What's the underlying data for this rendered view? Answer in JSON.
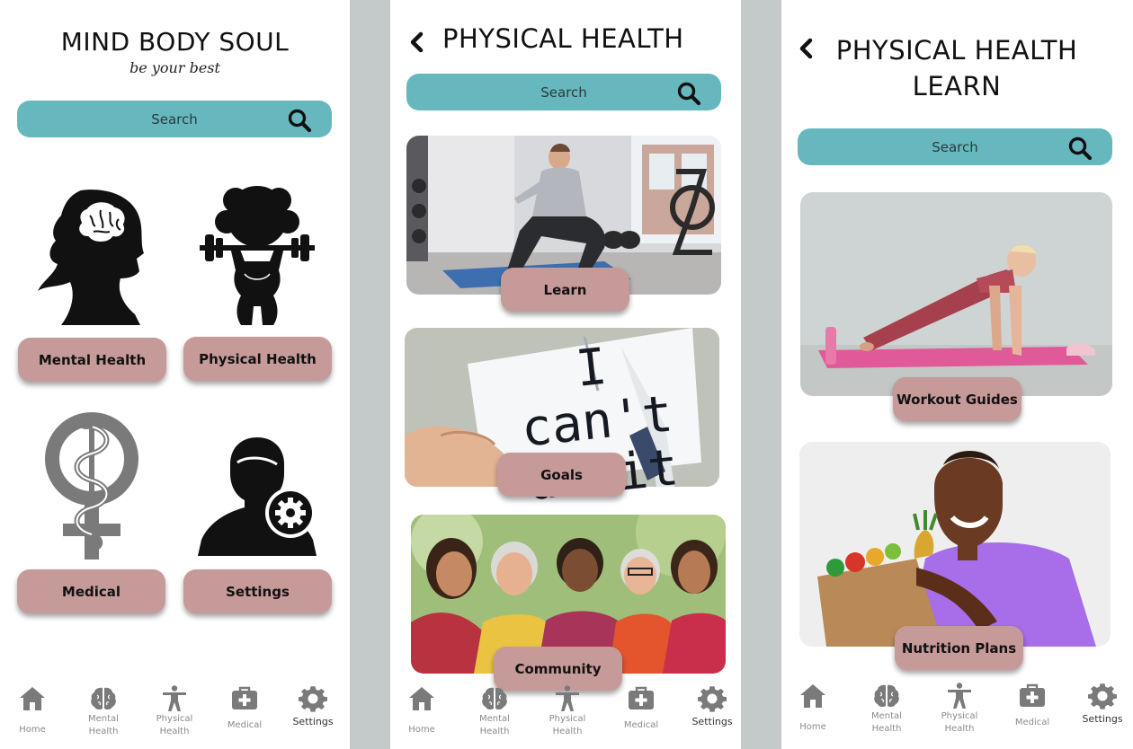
{
  "colors": {
    "search_bg": "#67b8be",
    "pill_bg": "#c79a9a",
    "icon_gray": "#7a7a7a",
    "divider": "#c4c9ca"
  },
  "home": {
    "brand_title": "MIND BODY SOUL",
    "brand_tagline": "be your best",
    "search_placeholder": "Search",
    "tiles": [
      {
        "label": "Mental Health",
        "icon": "woman-brain-silhouette-icon"
      },
      {
        "label": "Physical Health",
        "icon": "woman-barbell-silhouette-icon"
      },
      {
        "label": "Medical",
        "icon": "female-caduceus-icon"
      },
      {
        "label": "Settings",
        "icon": "user-gear-silhouette-icon"
      }
    ]
  },
  "physical": {
    "title": "PHYSICAL HEALTH",
    "search_placeholder": "Search",
    "cards": [
      {
        "label": "Learn",
        "photo": "woman squatting in gym"
      },
      {
        "label": "Goals",
        "photo": "card reading I can do it"
      },
      {
        "label": "Community",
        "photo": "group of smiling women"
      }
    ]
  },
  "learn": {
    "title_line1": "PHYSICAL HEALTH",
    "title_line2": "LEARN",
    "search_placeholder": "Search",
    "cards": [
      {
        "label": "Workout Guides",
        "photo": "woman doing plank on mat"
      },
      {
        "label": "Nutrition Plans",
        "photo": "woman holding grocery bag of produce"
      }
    ]
  },
  "nav": {
    "items": [
      {
        "id": "home",
        "label": "Home",
        "icon": "home-icon"
      },
      {
        "id": "mental",
        "label_1": "Mental",
        "label_2": "Health",
        "icon": "brain-icon"
      },
      {
        "id": "physical",
        "label_1": "Physical",
        "label_2": "Health",
        "icon": "person-icon"
      },
      {
        "id": "medical",
        "label": "Medical",
        "icon": "first-aid-kit-icon"
      },
      {
        "id": "settings",
        "label": "Settings",
        "icon": "gear-icon"
      }
    ]
  }
}
